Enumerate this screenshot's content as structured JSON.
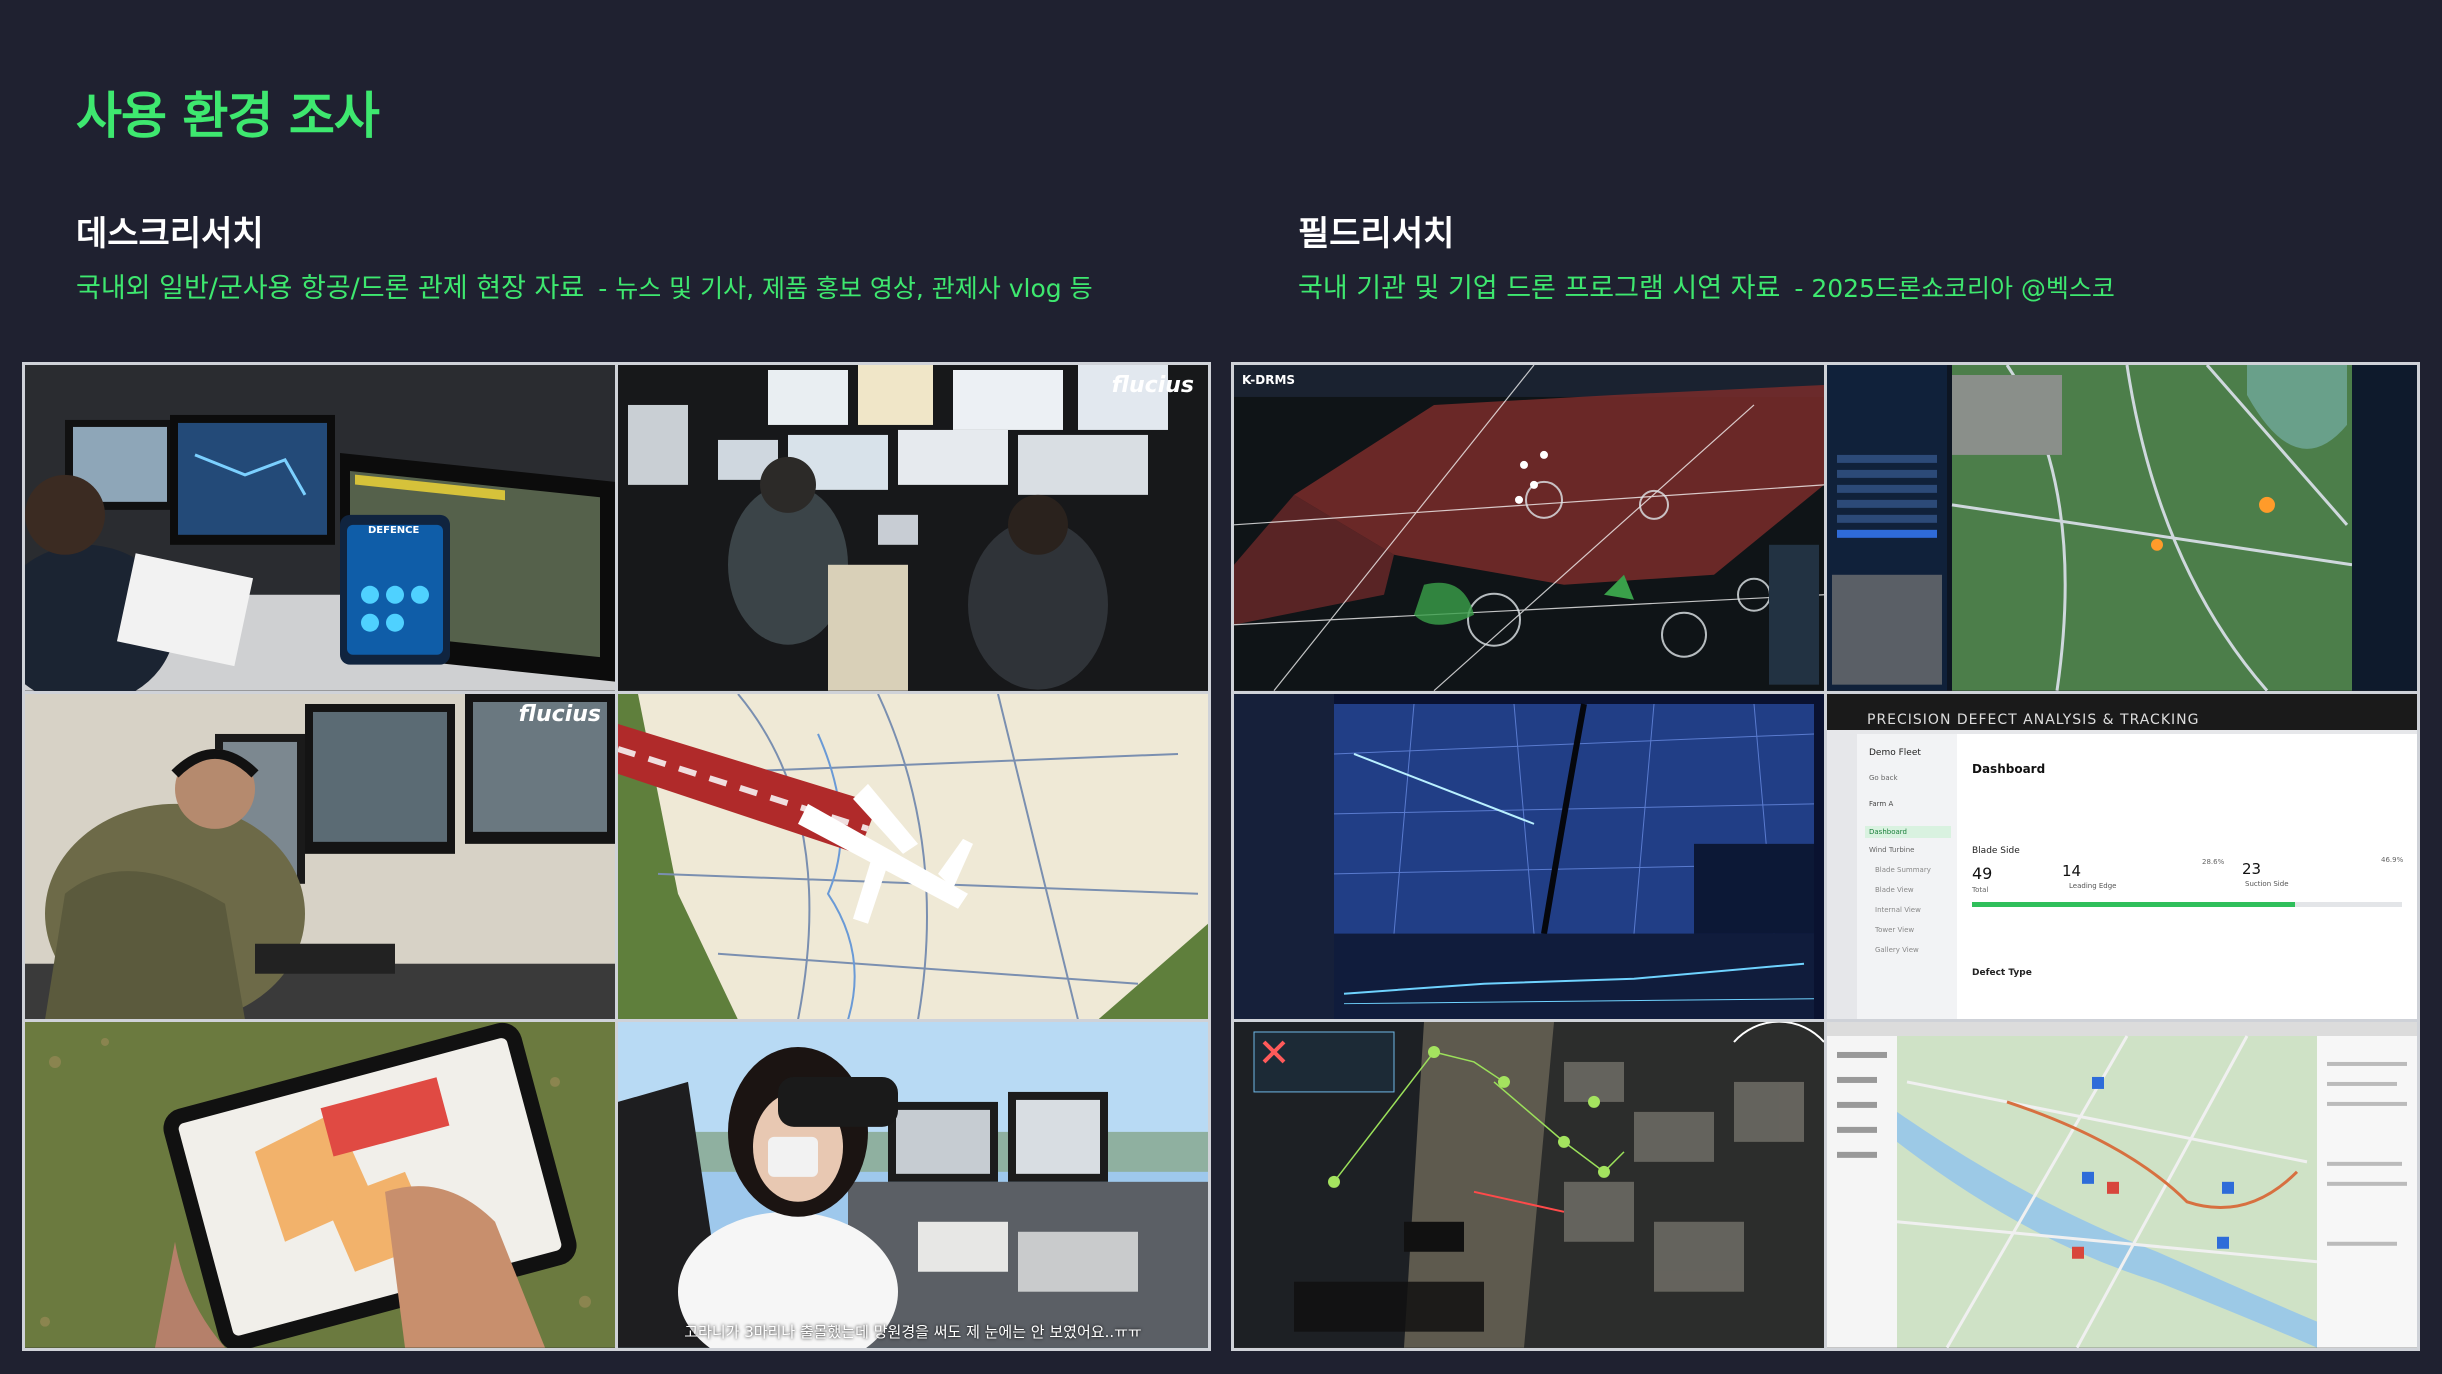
{
  "page": {
    "title": "사용 환경 조사"
  },
  "desk": {
    "title": "데스크리서치",
    "desc": "국내외 일반/군사용 항공/드론 관제 현장 자료",
    "sub": "- 뉴스 및 기사, 제품 홍보 영상, 관제사 vlog 등",
    "watermark1": "flucius",
    "watermark2": "flucius",
    "subtitle": "고라니가 3마리나 출몰했는데 망원경을 써도 제 눈에는 안 보였어요..ㅠㅠ",
    "defence_label": "DEFENCE"
  },
  "field": {
    "title": "필드리서치",
    "desc": "국내 기관 및 기업 드론 프로그램 시연 자료",
    "sub": "- 2025드론쇼코리아 @벡스코",
    "kdrms": "K-DRMS",
    "pdat_banner": "PRECISION DEFECT ANALYSIS & TRACKING",
    "dash_fleet": "Demo Fleet",
    "dash_title": "Dashboard",
    "dash_blade": "Blade Side",
    "dash_total_val": "49",
    "dash_total_lbl": "Total",
    "dash_le_val": "14",
    "dash_le_lbl": "Leading Edge",
    "dash_le_pct": "28.6%",
    "dash_ss_val": "23",
    "dash_ss_lbl": "Suction Side",
    "dash_ss_pct": "46.9%",
    "dash_defect": "Defect Type",
    "dash_nav": [
      "Go back",
      "Farm A",
      "Dashboard",
      "Wind Turbine",
      "Blade Summary",
      "Blade View",
      "Internal View",
      "Tower View",
      "Gallery View"
    ]
  }
}
